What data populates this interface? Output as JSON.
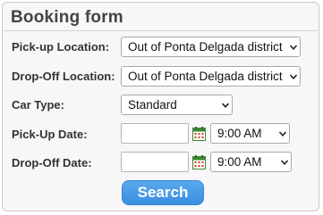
{
  "form": {
    "title": "Booking form",
    "pickup_location": {
      "label": "Pick-up Location:",
      "value": "Out of Ponta Delgada district"
    },
    "dropoff_location": {
      "label": "Drop-Off Location:",
      "value": "Out of Ponta Delgada district"
    },
    "car_type": {
      "label": "Car Type:",
      "value": "Standard"
    },
    "pickup_date": {
      "label": "Pick-Up Date:",
      "date_value": "",
      "time_value": "9:00 AM"
    },
    "dropoff_date": {
      "label": "Drop-Off Date:",
      "date_value": "",
      "time_value": "9:00 AM"
    },
    "search_label": "Search"
  },
  "icons": {
    "select_arrow": "chevron-down-icon",
    "calendar": "calendar-icon"
  },
  "colors": {
    "accent": "#3a8fe0",
    "calendar_green": "#3a8a2e",
    "calendar_red": "#d23a2a"
  }
}
